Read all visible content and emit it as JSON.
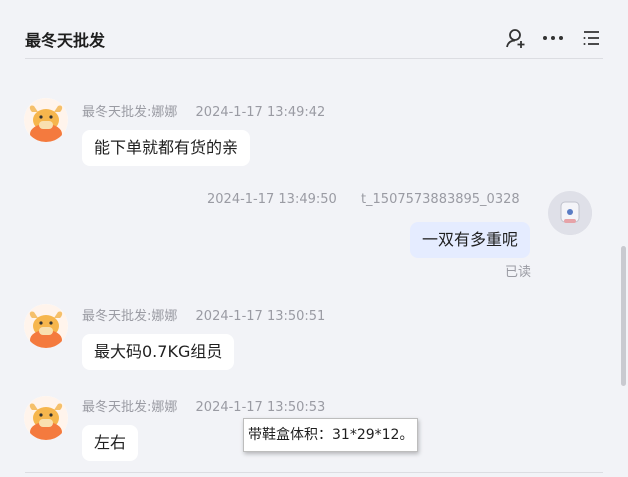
{
  "header": {
    "title": "最冬天批发",
    "icons": [
      "add-user-icon",
      "more-icon",
      "menu-icon"
    ]
  },
  "messages": [
    {
      "sender": "最冬天批发:娜娜",
      "time": "2024-1-17 13:49:42",
      "text": "能下单就都有货的亲",
      "side": "left"
    },
    {
      "sender": "t_1507573883895_0328",
      "time": "2024-1-17 13:49:50",
      "text": "一双有多重呢",
      "side": "right",
      "status": "已读"
    },
    {
      "sender": "最冬天批发:娜娜",
      "time": "2024-1-17 13:50:51",
      "text": "最大码0.7KG组员",
      "side": "left"
    },
    {
      "sender": "最冬天批发:娜娜",
      "time": "2024-1-17 13:50:53",
      "text": "左右",
      "side": "left"
    }
  ],
  "tooltip": {
    "text": "带鞋盒体积：31*29*12。"
  },
  "colors": {
    "background": "#f2f3f7",
    "bubble_other": "#ffffff",
    "bubble_self": "#e5ecff",
    "meta": "#9a9ba3",
    "avatar_orange": "#f47a3e"
  }
}
